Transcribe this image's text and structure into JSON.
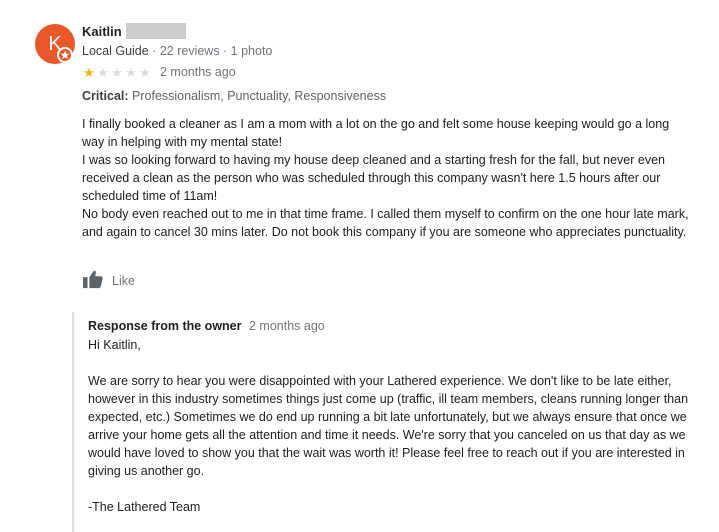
{
  "reviewer": {
    "initial": "K",
    "name": "Kaitlin",
    "guide": "Local Guide",
    "stats": " · 22 reviews · 1 photo",
    "avatar_color": "#e8582a"
  },
  "rating": {
    "value": 1,
    "max": 5,
    "date": "2 months ago",
    "star_color": "#f4b400"
  },
  "critical": {
    "label": "Critical:",
    "items": "Professionalism, Punctuality, Responsiveness"
  },
  "review_text": {
    "p1": "I finally booked a cleaner as I am a mom with a lot on the go and felt some house keeping would go a long way in helping with my mental state!",
    "p2": "I was so looking forward to having my house deep cleaned and a starting fresh for the fall, but never even received a clean as the person who was scheduled through this company wasn't here 1.5 hours after our scheduled time of 11am!",
    "p3": "No body even reached out to me in that time frame. I called them myself to confirm on the one hour late mark, and again to cancel 30 mins later. Do not book this company if you are someone who appreciates punctuality."
  },
  "actions": {
    "like_label": "Like",
    "like_icon": "thumbs-up-icon"
  },
  "owner_response": {
    "title": "Response from the owner",
    "date": "2 months ago",
    "greeting": "Hi Kaitlin,",
    "body": "We are sorry to hear you were disappointed with your Lathered experience. We don't like to be late either, however in this industry sometimes things just come up (traffic, ill team members, cleans running longer than expected, etc.) Sometimes we do end up running a bit late unfortunately, but we always ensure that once we arrive your home gets all the attention and time it needs. We're sorry that you canceled on us that day as we would have loved to show you that the wait was worth it! Please feel free to reach out if you are interested in giving us another go.",
    "signoff": "-The Lathered Team"
  }
}
